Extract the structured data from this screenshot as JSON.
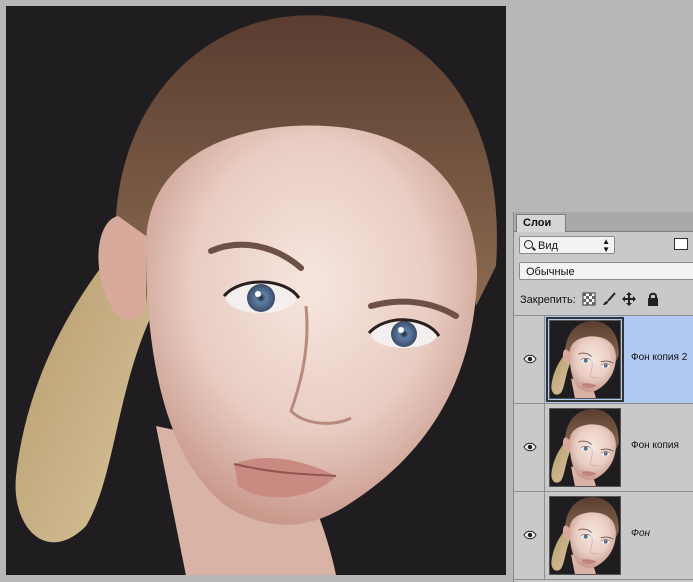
{
  "layers_panel": {
    "tab_label": "Слои",
    "filter_kind": "Вид",
    "blend_mode": "Обычные",
    "lock_label": "Закрепить:",
    "layers": [
      {
        "name": "Фон копия 2",
        "selected": true,
        "visible": true,
        "italic": false
      },
      {
        "name": "Фон копия",
        "selected": false,
        "visible": true,
        "italic": false
      },
      {
        "name": "Фон",
        "selected": false,
        "visible": true,
        "italic": true
      }
    ]
  },
  "colors": {
    "canvas_background": "#1f1d20",
    "panel_background": "#c9c9c9",
    "selected_layer": "#b1c9f2",
    "workspace": "#b7b7b7"
  }
}
